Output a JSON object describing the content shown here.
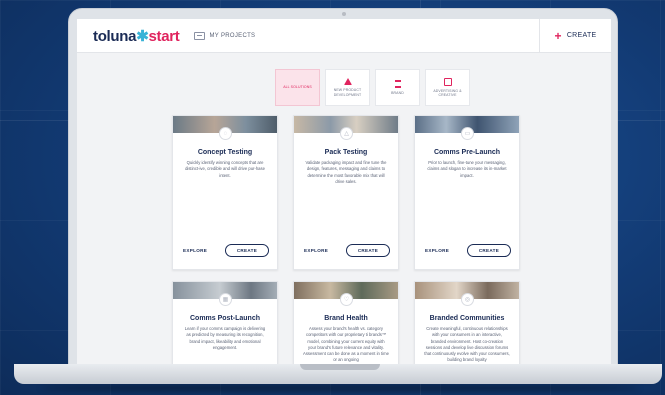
{
  "app": {
    "logo_main": "toluna",
    "logo_star": "✱",
    "logo_suffix": "start",
    "my_projects": "MY PROJECTS",
    "create": "CREATE"
  },
  "filters": [
    {
      "label": "ALL SOLUTIONS",
      "active": true
    },
    {
      "label": "NEW PRODUCT DEVELOPMENT",
      "active": false
    },
    {
      "label": "BRAND",
      "active": false
    },
    {
      "label": "ADVERTISING & CREATIVE",
      "active": false
    }
  ],
  "cards": [
    {
      "title": "Concept Testing",
      "desc": "Quickly identify winning concepts that are distinct-ive, credible and will drive pur-hase intent.",
      "explore": "EXPLORE",
      "create": "CREATE"
    },
    {
      "title": "Pack Testing",
      "desc": "Validate packaging impact and fine tune the design, features, messaging and claims to determine the most favorable mix that will drive sales.",
      "explore": "EXPLORE",
      "create": "CREATE"
    },
    {
      "title": "Comms Pre-Launch",
      "desc": "Prior to launch, fine-tune your messaging, claims and slogan to increase its in-market impact.",
      "explore": "EXPLORE",
      "create": "CREATE"
    },
    {
      "title": "Comms Post-Launch",
      "desc": "Learn if your comms campaign is delivering as predicted by measuring its recognition, brand impact, likeability and emotional engagement."
    },
    {
      "title": "Brand Health",
      "desc": "Assess your brand's health vs. category competitors with our proprietary ti brands™ model, combining your current equity with your brand's future relevance and vitality. Assessment can be done as a moment in time or an ongoing"
    },
    {
      "title": "Branded Communities",
      "desc": "Create meaningful, continuous relationships with your consumers in an interactive, branded environment. Host co-creation sessions and develop live discussion forums that continuously evolve with your consumers, building brand loyalty"
    }
  ]
}
